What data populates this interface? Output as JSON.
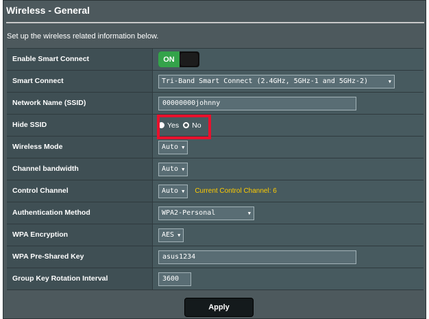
{
  "page": {
    "title": "Wireless - General",
    "subtitle": "Set up the wireless related information below."
  },
  "settings": {
    "smart_connect_toggle": {
      "label": "Enable Smart Connect",
      "state": "ON"
    },
    "smart_connect": {
      "label": "Smart Connect",
      "value": "Tri-Band Smart Connect (2.4GHz, 5GHz-1 and 5GHz-2)"
    },
    "ssid": {
      "label": "Network Name (SSID)",
      "value": "00000000johnny"
    },
    "hide_ssid": {
      "label": "Hide SSID",
      "yes_label": "Yes",
      "no_label": "No",
      "selected": "No"
    },
    "wireless_mode": {
      "label": "Wireless Mode",
      "value": "Auto"
    },
    "channel_bandwidth": {
      "label": "Channel bandwidth",
      "value": "Auto"
    },
    "control_channel": {
      "label": "Control Channel",
      "value": "Auto",
      "current": "Current Control Channel: 6"
    },
    "auth_method": {
      "label": "Authentication Method",
      "value": "WPA2-Personal"
    },
    "wpa_encryption": {
      "label": "WPA Encryption",
      "value": "AES"
    },
    "psk": {
      "label": "WPA Pre-Shared Key",
      "value": "asus1234"
    },
    "group_key_rotation": {
      "label": "Group Key Rotation Interval",
      "value": "3600"
    }
  },
  "actions": {
    "apply_label": "Apply"
  },
  "colors": {
    "highlight": "#e8112d",
    "toggle_on": "#34a34a",
    "current_channel_text": "#ffcc00"
  },
  "icons": {
    "dropdown": "caret-down-icon"
  }
}
